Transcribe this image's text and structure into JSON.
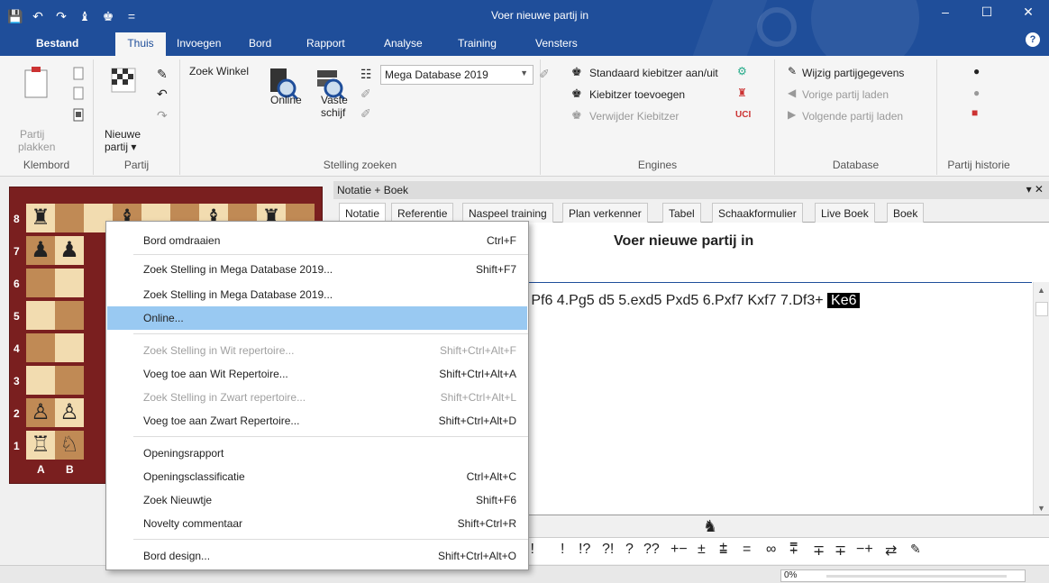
{
  "app": {
    "title": "Voer nieuwe partij in",
    "quick_access": [
      "💾",
      "↶",
      "↷",
      "♝",
      "♚",
      "="
    ],
    "window_buttons": [
      "–",
      "☐",
      "✕"
    ]
  },
  "ribbon_tabs": [
    {
      "label": "Bestand"
    },
    {
      "label": "Thuis"
    },
    {
      "label": "Invoegen"
    },
    {
      "label": "Bord"
    },
    {
      "label": "Rapport"
    },
    {
      "label": "Analyse"
    },
    {
      "label": "Training"
    },
    {
      "label": "Vensters"
    }
  ],
  "ribbon": {
    "klembord": {
      "label": "Klembord",
      "paste_line1": "Partij",
      "paste_line2": "plakken"
    },
    "partij": {
      "label": "Partij",
      "new_line1": "Nieuwe",
      "new_line2": "partij ▾"
    },
    "zoek": {
      "label": "Stelling zoeken",
      "winkel": "Zoek Winkel",
      "online": "Online",
      "vaste1": "Vaste",
      "vaste2": "schijf",
      "database": "Mega Database 2019"
    },
    "engines": {
      "label": "Engines",
      "std_kibitzer": "Standaard kiebitzer aan/uit",
      "add_kibitzer": "Kiebitzer toevoegen",
      "remove_kibitzer": "Verwijder Kiebitzer"
    },
    "database": {
      "label": "Database",
      "edit": "Wijzig partijgegevens",
      "prev": "Vorige partij laden",
      "next": "Volgende partij laden"
    },
    "history": {
      "label": "Partij historie"
    }
  },
  "board": {
    "ranks": [
      "8",
      "7",
      "6",
      "5",
      "4",
      "3",
      "2",
      "1"
    ],
    "files": [
      "A",
      "B"
    ]
  },
  "notation_panel": {
    "header": "Notatie + Boek",
    "close": "▾ ✕",
    "tabs": [
      "Notatie",
      "Referentie",
      "Naspeel training",
      "Plan verkenner",
      "Tabel",
      "Schaakformulier",
      "Live Boek",
      "Boek"
    ],
    "game_title": "Voer nieuwe partij in",
    "moves": "4 Pf6 4.Pg5 d5 5.exd5 Pxd5 6.Pxf7 Kxf7 7.Df3+",
    "current_move": "Ke6"
  },
  "annotations": [
    "!!",
    "!",
    "!?",
    "?!",
    "?",
    "??",
    "+−",
    "±",
    "⩲",
    "=",
    "∞",
    "⩱",
    "∓",
    "∓",
    "−+",
    "⇄"
  ],
  "progress": {
    "text": "0%",
    "value": 0
  },
  "context_menu": [
    {
      "label": "Bord omdraaien",
      "shortcut": "Ctrl+F",
      "disabled": false
    },
    {
      "label": "Zoek Stelling in Mega Database 2019...",
      "shortcut": "Shift+F7",
      "disabled": false
    },
    {
      "label": "Zoek Stelling in Mega Database 2019...",
      "shortcut": "",
      "disabled": false
    },
    {
      "label": "Online...",
      "shortcut": "",
      "disabled": false,
      "highlighted": true
    },
    {
      "label": "Zoek Stelling in Wit repertoire...",
      "shortcut": "Shift+Ctrl+Alt+F",
      "disabled": true
    },
    {
      "label": "Voeg toe aan Wit Repertoire...",
      "shortcut": "Shift+Ctrl+Alt+A",
      "disabled": false
    },
    {
      "label": "Zoek Stelling in Zwart repertoire...",
      "shortcut": "Shift+Ctrl+Alt+L",
      "disabled": true
    },
    {
      "label": "Voeg toe aan Zwart Repertoire...",
      "shortcut": "Shift+Ctrl+Alt+D",
      "disabled": false
    },
    {
      "label": "Openingsrapport",
      "shortcut": "",
      "disabled": false
    },
    {
      "label": "Openingsclassificatie",
      "shortcut": "Ctrl+Alt+C",
      "disabled": false
    },
    {
      "label": "Zoek Nieuwtje",
      "shortcut": "Shift+F6",
      "disabled": false
    },
    {
      "label": "Novelty commentaar",
      "shortcut": "Shift+Ctrl+R",
      "disabled": false
    },
    {
      "label": "Bord design...",
      "shortcut": "Shift+Ctrl+Alt+O",
      "disabled": false
    }
  ]
}
